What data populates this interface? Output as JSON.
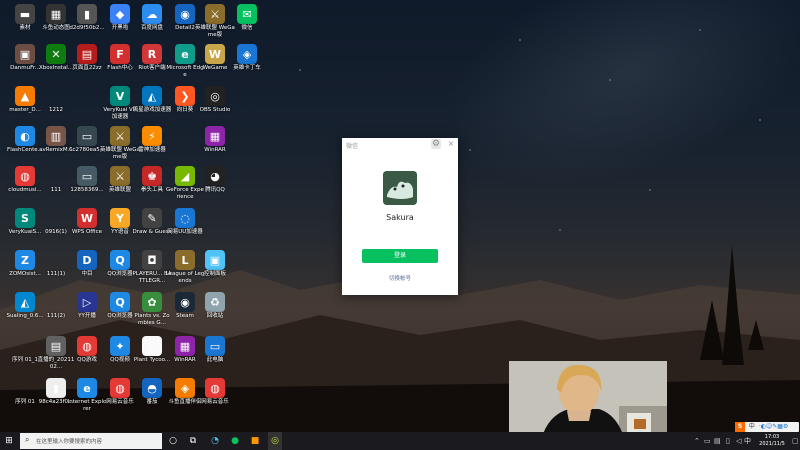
{
  "desktop": {
    "icons": [
      {
        "label": "素材",
        "glyph": "▬",
        "color": "#444"
      },
      {
        "label": "斗鱼动态图",
        "glyph": "▦",
        "color": "#333"
      },
      {
        "label": "d2d9f50b2...",
        "glyph": "▮",
        "color": "#555"
      },
      {
        "label": "开黑啦",
        "glyph": "◆",
        "color": "#3b82f6"
      },
      {
        "label": "百度网盘",
        "glyph": "☁",
        "color": "#2d8cf0"
      },
      {
        "label": "Detail2",
        "glyph": "◉",
        "color": "#1565c0"
      },
      {
        "label": "英雄联盟 WeGame版",
        "glyph": "⚔",
        "color": "#8a6d2b"
      },
      {
        "label": "微信",
        "glyph": "✉",
        "color": "#07c160"
      },
      {
        "label": "DanmuFr...",
        "glyph": "▣",
        "color": "#6d4c41"
      },
      {
        "label": "XboxInstal...",
        "glyph": "✕",
        "color": "#107c10"
      },
      {
        "label": "页面直22zz",
        "glyph": "▤",
        "color": "#b71c1c"
      },
      {
        "label": "Flash中心",
        "glyph": "F",
        "color": "#d32f2f"
      },
      {
        "label": "Riot客户端",
        "glyph": "R",
        "color": "#d13639"
      },
      {
        "label": "Microsoft Edge",
        "glyph": "e",
        "color": "#0f9d8a"
      },
      {
        "label": "WeGame",
        "glyph": "W",
        "color": "#c9a64a"
      },
      {
        "label": "英雄卡丁车",
        "glyph": "◈",
        "color": "#1976d2"
      },
      {
        "label": "master_D...",
        "glyph": "▲",
        "color": "#f57c00"
      },
      {
        "label": "1212",
        "glyph": "",
        "color": "transparent"
      },
      {
        "label": "VeryKuai VR 加速器",
        "glyph": "V",
        "color": "#00897b"
      },
      {
        "label": "流星游戏加速器",
        "glyph": "◭",
        "color": "#0277bd"
      },
      {
        "label": "向日葵",
        "glyph": "❯",
        "color": "#ff5722"
      },
      {
        "label": "OBS Studio",
        "glyph": "◎",
        "color": "#222"
      },
      {
        "label": "FlashCente...",
        "glyph": "◐",
        "color": "#1e88e5"
      },
      {
        "label": "avRemixM...",
        "glyph": "▥",
        "color": "#795548"
      },
      {
        "label": "6c2780ea5...",
        "glyph": "▭",
        "color": "#37474f"
      },
      {
        "label": "英雄联盟 WeGame版",
        "glyph": "⚔",
        "color": "#8a6d2b"
      },
      {
        "label": "雷神加速器",
        "glyph": "⚡",
        "color": "#fb8c00"
      },
      {
        "label": "WinRAR",
        "glyph": "▦",
        "color": "#8e24aa"
      },
      {
        "label": "cloudmusi...",
        "glyph": "◍",
        "color": "#e53935"
      },
      {
        "label": "111",
        "glyph": "",
        "color": "transparent"
      },
      {
        "label": "12858369...",
        "glyph": "▭",
        "color": "#455a64"
      },
      {
        "label": "英雄联盟",
        "glyph": "⚔",
        "color": "#8a6d2b"
      },
      {
        "label": "拳头工具",
        "glyph": "♚",
        "color": "#c62828"
      },
      {
        "label": "GeForce Experience",
        "glyph": "◢",
        "color": "#76b900"
      },
      {
        "label": "腾讯QQ",
        "glyph": "◕",
        "color": "#222"
      },
      {
        "label": "VeryKuaiS...",
        "glyph": "S",
        "color": "#00897b"
      },
      {
        "label": "0916(1)",
        "glyph": "",
        "color": "transparent"
      },
      {
        "label": "WPS Office",
        "glyph": "W",
        "color": "#d32f2f"
      },
      {
        "label": "YY语音",
        "glyph": "Y",
        "color": "#f9a825"
      },
      {
        "label": "Draw & Guess",
        "glyph": "✎",
        "color": "#424242"
      },
      {
        "label": "网易UU加速器",
        "glyph": "◌",
        "color": "#1976d2"
      },
      {
        "label": "ZOMOsist...",
        "glyph": "Z",
        "color": "#1e88e5"
      },
      {
        "label": "111(1)",
        "glyph": "",
        "color": "transparent"
      },
      {
        "label": "中目",
        "glyph": "D",
        "color": "#1565c0"
      },
      {
        "label": "QQ浏览器",
        "glyph": "Q",
        "color": "#1e88e5"
      },
      {
        "label": "PLAYERU... BATTLEGR...",
        "glyph": "◘",
        "color": "#424242"
      },
      {
        "label": "League of Legends",
        "glyph": "L",
        "color": "#8a6d2b"
      },
      {
        "label": "控制面板",
        "glyph": "▣",
        "color": "#4fc3f7"
      },
      {
        "label": "Sualing_0.6...",
        "glyph": "◭",
        "color": "#0288d1"
      },
      {
        "label": "111(2)",
        "glyph": "",
        "color": "transparent"
      },
      {
        "label": "YY开播",
        "glyph": "▷",
        "color": "#283593"
      },
      {
        "label": "QQ浏览器",
        "glyph": "Q",
        "color": "#1e88e5"
      },
      {
        "label": "Plants vs. Zombies G...",
        "glyph": "✿",
        "color": "#388e3c"
      },
      {
        "label": "Steam",
        "glyph": "◉",
        "color": "#1b2838"
      },
      {
        "label": "回收站",
        "glyph": "♻",
        "color": "#90a4ae"
      },
      {
        "label": "序列 01_1",
        "glyph": "",
        "color": "transparent"
      },
      {
        "label": "直播的_2021102...",
        "glyph": "▤",
        "color": "#616161"
      },
      {
        "label": "QQ游戏",
        "glyph": "◍",
        "color": "#e53935"
      },
      {
        "label": "QQ视频",
        "glyph": "✦",
        "color": "#1e88e5"
      },
      {
        "label": "Plant Tycoo...",
        "glyph": "▯",
        "color": "#fafafa"
      },
      {
        "label": "WinRAR",
        "glyph": "▦",
        "color": "#8e24aa"
      },
      {
        "label": "此电脑",
        "glyph": "▭",
        "color": "#1976d2"
      },
      {
        "label": "序列 01",
        "glyph": "",
        "color": "transparent"
      },
      {
        "label": "98c4a23f0...",
        "glyph": "▮",
        "color": "#eeeeee"
      },
      {
        "label": "Internet Explorer",
        "glyph": "e",
        "color": "#1e88e5"
      },
      {
        "label": "网易云音乐",
        "glyph": "◍",
        "color": "#e53935"
      },
      {
        "label": "番茄",
        "glyph": "◓",
        "color": "#1565c0"
      },
      {
        "label": "斗鱼直播伴侣",
        "glyph": "◈",
        "color": "#f57c00"
      },
      {
        "label": "网易云音乐",
        "glyph": "◍",
        "color": "#e53935"
      }
    ]
  },
  "dialog": {
    "title": "微信",
    "username": "Sakura",
    "login_label": "登录",
    "switch_label": "切换帐号",
    "settings_icon": "gear-icon",
    "close_glyph": "×"
  },
  "taskbar": {
    "search_placeholder": "在这里输入你要搜索的内容",
    "apps": [
      "task-view",
      "file-explorer",
      "edge",
      "wechat",
      "douyu",
      "obs"
    ]
  },
  "tray": {
    "ime_label": "中",
    "time": "17:03",
    "date": "2021/11/5"
  }
}
